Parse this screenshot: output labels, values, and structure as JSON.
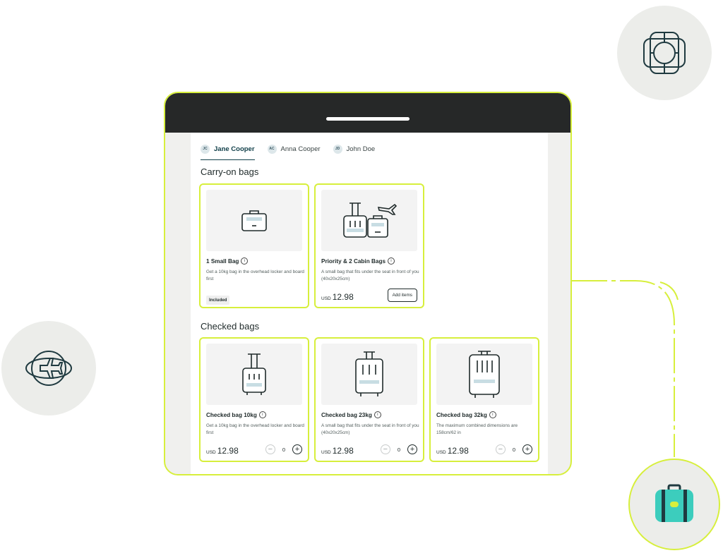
{
  "passengers": [
    {
      "initials": "JC",
      "name": "Jane Cooper",
      "active": true
    },
    {
      "initials": "AC",
      "name": "Anna Cooper",
      "active": false
    },
    {
      "initials": "JD",
      "name": "John Doe",
      "active": false
    }
  ],
  "carry_on": {
    "title": "Carry-on bags",
    "cards": [
      {
        "title": "1 Small Bag",
        "desc": "Get a 10kg bag in the overhead locker and board first",
        "badge": "Included",
        "icon": "small-bag-icon"
      },
      {
        "title": "Priority & 2 Cabin Bags",
        "desc": "A small bag that fits under the seat in front of you (40x20x25cm)",
        "currency": "USD",
        "price": "12.98",
        "button": "Add items",
        "icon": "cabin-bags-icon"
      }
    ]
  },
  "checked": {
    "title": "Checked bags",
    "cards": [
      {
        "title": "Checked bag 10kg",
        "desc": "Get a 10kg bag in the overhead locker and board first",
        "currency": "USD",
        "price": "12.98",
        "quantity": "0",
        "icon": "suitcase-small-icon"
      },
      {
        "title": "Checked bag 23kg",
        "desc": "A small bag that fits under the seat in front of you (40x20x25cm)",
        "currency": "USD",
        "price": "12.98",
        "quantity": "0",
        "icon": "suitcase-medium-icon"
      },
      {
        "title": "Checked bag 32kg",
        "desc": "The maximum combined dimensions are 158cm/62 in",
        "currency": "USD",
        "price": "12.98",
        "quantity": "0",
        "icon": "suitcase-large-icon"
      }
    ]
  },
  "colors": {
    "accent": "#d7ef3c",
    "device_top": "#262828",
    "teal": "#3ccdbd",
    "text": "#1f2a2a"
  }
}
